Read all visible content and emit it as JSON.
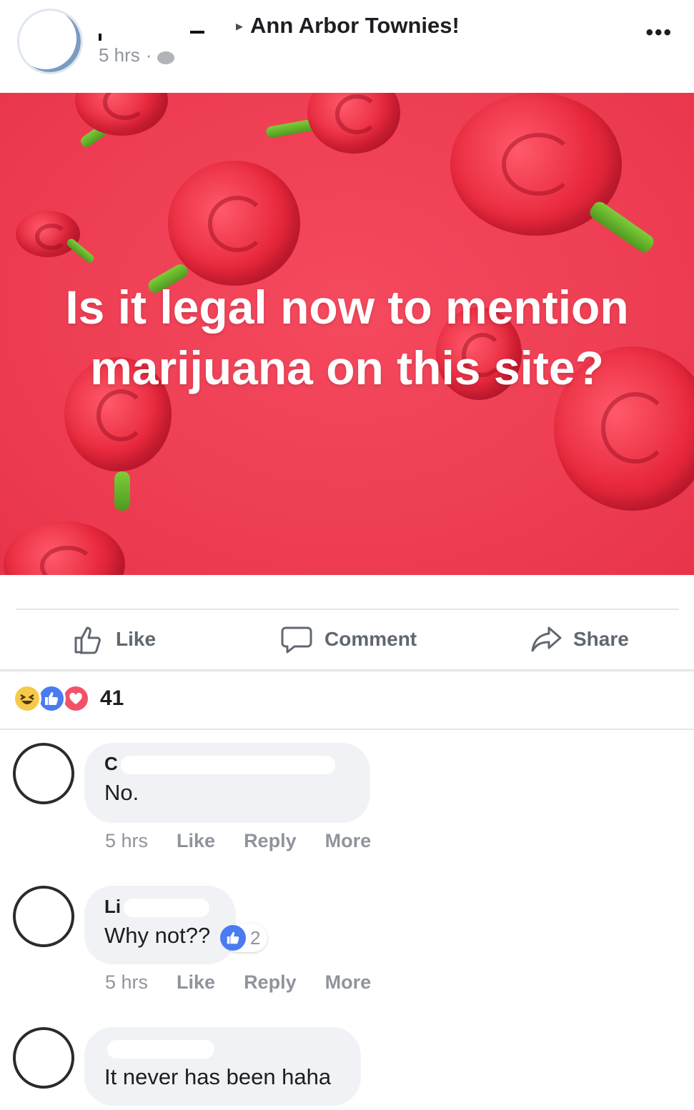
{
  "header": {
    "group_name": "Ann Arbor Townies!",
    "arrow": "▸",
    "time": "5 hrs",
    "dot": "·",
    "globe_icon": "globe-icon",
    "more": "•••"
  },
  "post": {
    "headline": "Is it legal now to mention marijuana on this site?",
    "background_color": "#ee3e53"
  },
  "actions": {
    "like": "Like",
    "comment": "Comment",
    "share": "Share"
  },
  "reactions": {
    "count": "41",
    "icons": [
      "haha-icon",
      "like-icon",
      "love-icon"
    ]
  },
  "comments": [
    {
      "name": "C",
      "text": "No.",
      "time": "5 hrs",
      "like": "Like",
      "reply": "Reply",
      "more": "More"
    },
    {
      "name": "Li",
      "text": "Why not??",
      "likes": "2",
      "time": "5 hrs",
      "like": "Like",
      "reply": "Reply",
      "more": "More"
    },
    {
      "name": "",
      "text": "It never has been haha"
    }
  ]
}
